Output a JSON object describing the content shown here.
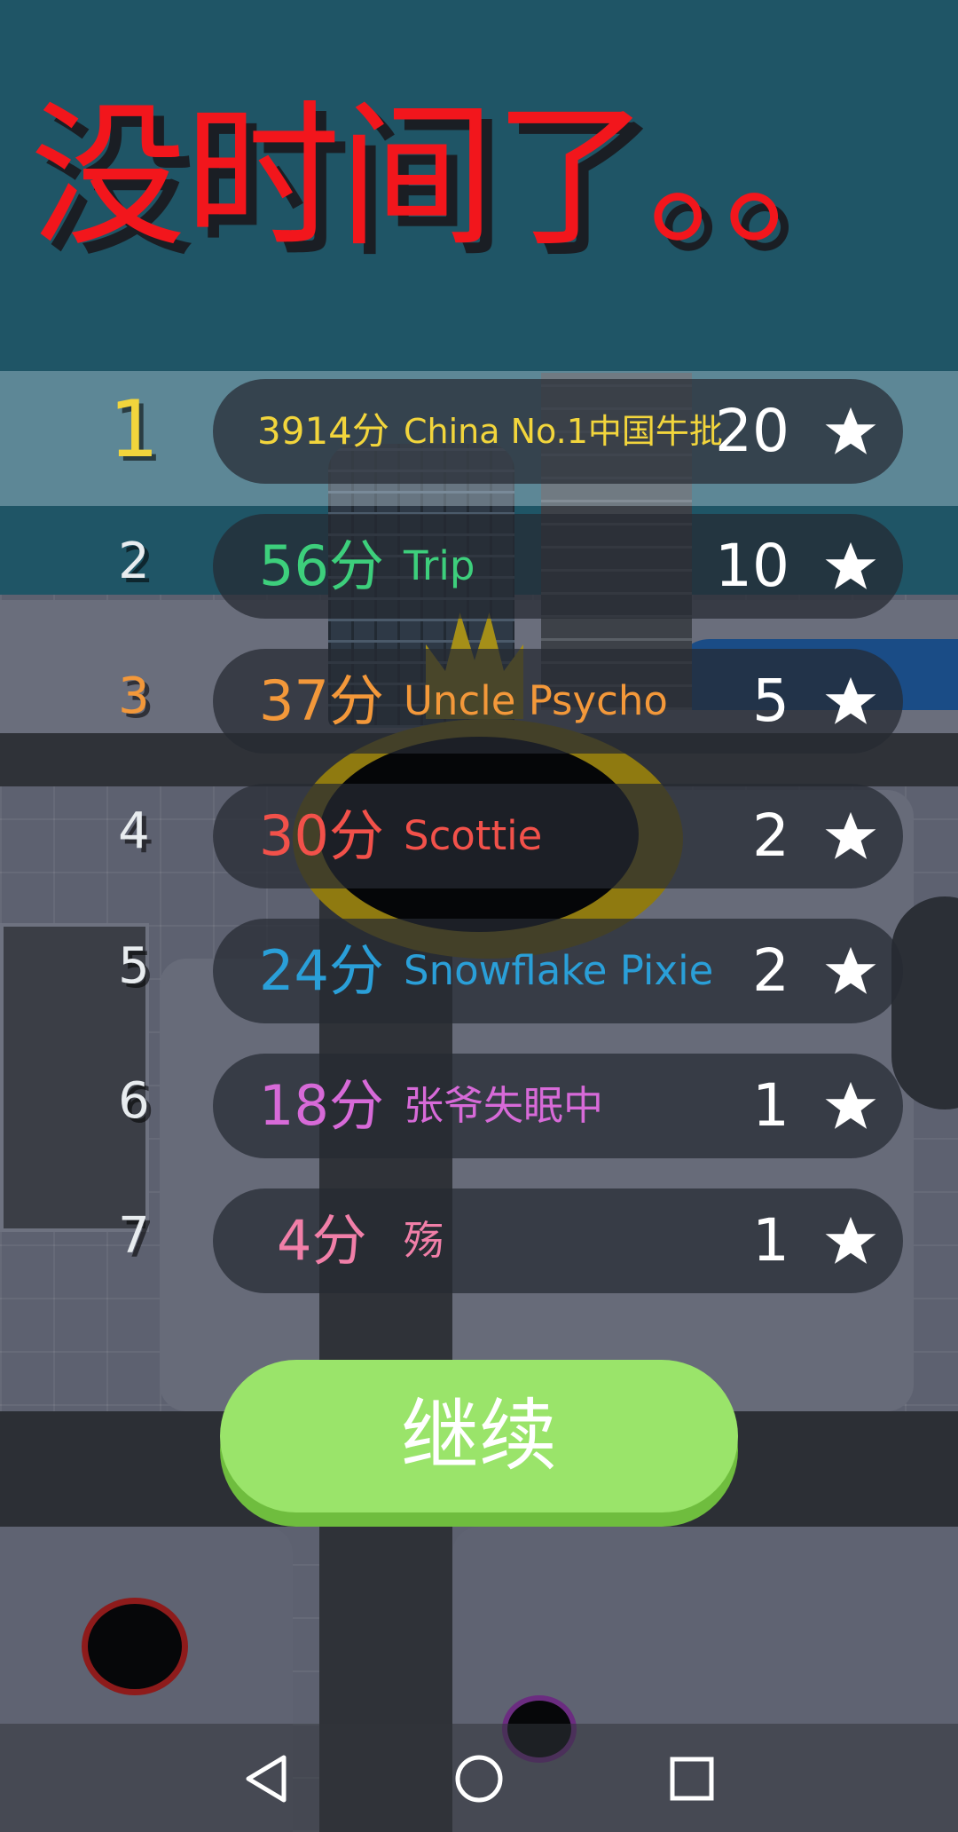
{
  "title": "没时间了。。",
  "leaderboard": [
    {
      "rank": "1",
      "score": "3914分",
      "name": "China No.1中国牛批",
      "stars": "20",
      "color": "#f2d53c",
      "highlight": true
    },
    {
      "rank": "2",
      "score": "56分",
      "name": "Trip",
      "stars": "10",
      "color": "#3dcf7c",
      "highlight": false
    },
    {
      "rank": "3",
      "score": "37分",
      "name": "Uncle Psycho",
      "stars": "5",
      "color": "#f3983a",
      "highlight": false
    },
    {
      "rank": "4",
      "score": "30分",
      "name": "Scottie",
      "stars": "2",
      "color": "#f2514a",
      "highlight": false
    },
    {
      "rank": "5",
      "score": "24分",
      "name": "Snowflake Pixie",
      "stars": "2",
      "color": "#2a9fd8",
      "highlight": false
    },
    {
      "rank": "6",
      "score": "18分",
      "name": "张爷失眠中",
      "stars": "1",
      "color": "#d76ad8",
      "highlight": false
    },
    {
      "rank": "7",
      "score": "4分",
      "name": "殇",
      "stars": "1",
      "color": "#f17fa8",
      "highlight": false
    }
  ],
  "continue_label": "继续",
  "map_labels": {
    "hole_a": "Scottie",
    "hole_b": "张爷失眠中"
  },
  "navbar": {
    "back": "back-icon",
    "home": "home-icon",
    "recents": "recents-icon"
  }
}
